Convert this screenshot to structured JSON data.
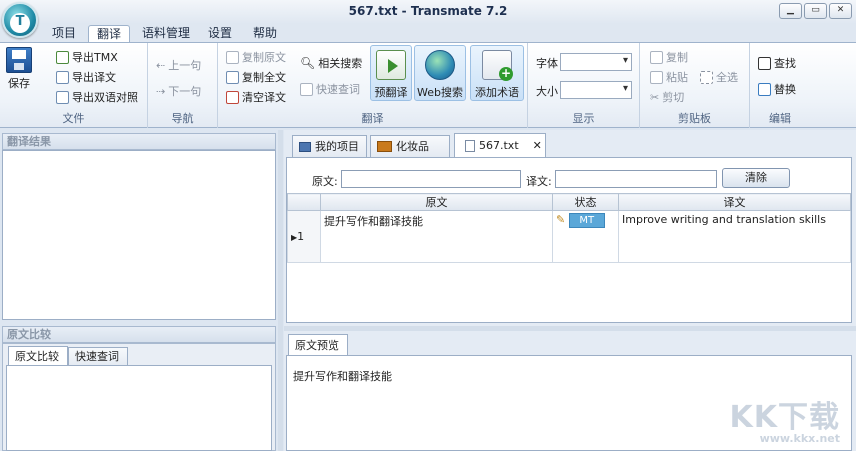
{
  "window": {
    "title": "567.txt - Transmate 7.2",
    "logo_letter": "T",
    "buttons": [
      "▁",
      "▭",
      "✕"
    ]
  },
  "menu": [
    "项目",
    "翻译",
    "语料管理",
    "设置",
    "帮助"
  ],
  "ribbon": {
    "file": {
      "label": "文件",
      "save": "保存",
      "export_tmx": "导出TMX",
      "export_translation": "导出译文",
      "export_bilingual": "导出双语对照"
    },
    "nav": {
      "label": "导航",
      "prev": "上一句",
      "next": "下一句"
    },
    "translate": {
      "label": "翻译",
      "copy_source": "复制原文",
      "copy_all": "复制全文",
      "clear_translation": "清空译文",
      "related_search": "相关搜索",
      "quick_lookup": "快速查词",
      "pre_translate": "预翻译",
      "web_search": "Web搜索",
      "add_term": "添加术语"
    },
    "display": {
      "label": "显示",
      "font_label": "字体",
      "size_label": "大小"
    },
    "clipboard": {
      "label": "剪贴板",
      "copy": "复制",
      "paste": "粘贴",
      "select_all": "全选",
      "cut": "剪切"
    },
    "edit": {
      "label": "编辑",
      "find": "查找",
      "replace": "替换"
    }
  },
  "left": {
    "results_title": "翻译结果",
    "compare_title": "原文比较",
    "tabs": [
      "原文比较",
      "快速查词"
    ]
  },
  "doc_tabs": [
    "我的项目",
    "化妆品",
    "567.txt"
  ],
  "filter": {
    "source_label": "原文:",
    "target_label": "译文:",
    "clear": "清除"
  },
  "table": {
    "headers": [
      "原文",
      "状态",
      "译文"
    ],
    "rows": [
      {
        "num": "1",
        "source": "提升写作和翻译技能",
        "status": "MT",
        "target": "Improve writing and translation skills"
      }
    ]
  },
  "preview": {
    "tab": "原文预览",
    "text": "提升写作和翻译技能"
  },
  "watermark": {
    "main": "KK下载",
    "url": "www.kkx.net"
  }
}
